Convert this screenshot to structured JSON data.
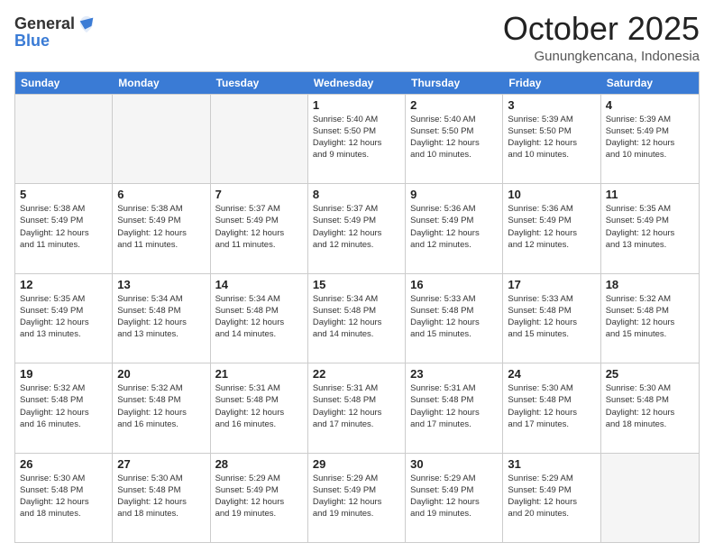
{
  "header": {
    "logo_line1": "General",
    "logo_line2": "Blue",
    "month_title": "October 2025",
    "location": "Gunungkencana, Indonesia"
  },
  "day_headers": [
    "Sunday",
    "Monday",
    "Tuesday",
    "Wednesday",
    "Thursday",
    "Friday",
    "Saturday"
  ],
  "weeks": [
    [
      {
        "num": "",
        "info": ""
      },
      {
        "num": "",
        "info": ""
      },
      {
        "num": "",
        "info": ""
      },
      {
        "num": "1",
        "info": "Sunrise: 5:40 AM\nSunset: 5:50 PM\nDaylight: 12 hours\nand 9 minutes."
      },
      {
        "num": "2",
        "info": "Sunrise: 5:40 AM\nSunset: 5:50 PM\nDaylight: 12 hours\nand 10 minutes."
      },
      {
        "num": "3",
        "info": "Sunrise: 5:39 AM\nSunset: 5:50 PM\nDaylight: 12 hours\nand 10 minutes."
      },
      {
        "num": "4",
        "info": "Sunrise: 5:39 AM\nSunset: 5:49 PM\nDaylight: 12 hours\nand 10 minutes."
      }
    ],
    [
      {
        "num": "5",
        "info": "Sunrise: 5:38 AM\nSunset: 5:49 PM\nDaylight: 12 hours\nand 11 minutes."
      },
      {
        "num": "6",
        "info": "Sunrise: 5:38 AM\nSunset: 5:49 PM\nDaylight: 12 hours\nand 11 minutes."
      },
      {
        "num": "7",
        "info": "Sunrise: 5:37 AM\nSunset: 5:49 PM\nDaylight: 12 hours\nand 11 minutes."
      },
      {
        "num": "8",
        "info": "Sunrise: 5:37 AM\nSunset: 5:49 PM\nDaylight: 12 hours\nand 12 minutes."
      },
      {
        "num": "9",
        "info": "Sunrise: 5:36 AM\nSunset: 5:49 PM\nDaylight: 12 hours\nand 12 minutes."
      },
      {
        "num": "10",
        "info": "Sunrise: 5:36 AM\nSunset: 5:49 PM\nDaylight: 12 hours\nand 12 minutes."
      },
      {
        "num": "11",
        "info": "Sunrise: 5:35 AM\nSunset: 5:49 PM\nDaylight: 12 hours\nand 13 minutes."
      }
    ],
    [
      {
        "num": "12",
        "info": "Sunrise: 5:35 AM\nSunset: 5:49 PM\nDaylight: 12 hours\nand 13 minutes."
      },
      {
        "num": "13",
        "info": "Sunrise: 5:34 AM\nSunset: 5:48 PM\nDaylight: 12 hours\nand 13 minutes."
      },
      {
        "num": "14",
        "info": "Sunrise: 5:34 AM\nSunset: 5:48 PM\nDaylight: 12 hours\nand 14 minutes."
      },
      {
        "num": "15",
        "info": "Sunrise: 5:34 AM\nSunset: 5:48 PM\nDaylight: 12 hours\nand 14 minutes."
      },
      {
        "num": "16",
        "info": "Sunrise: 5:33 AM\nSunset: 5:48 PM\nDaylight: 12 hours\nand 15 minutes."
      },
      {
        "num": "17",
        "info": "Sunrise: 5:33 AM\nSunset: 5:48 PM\nDaylight: 12 hours\nand 15 minutes."
      },
      {
        "num": "18",
        "info": "Sunrise: 5:32 AM\nSunset: 5:48 PM\nDaylight: 12 hours\nand 15 minutes."
      }
    ],
    [
      {
        "num": "19",
        "info": "Sunrise: 5:32 AM\nSunset: 5:48 PM\nDaylight: 12 hours\nand 16 minutes."
      },
      {
        "num": "20",
        "info": "Sunrise: 5:32 AM\nSunset: 5:48 PM\nDaylight: 12 hours\nand 16 minutes."
      },
      {
        "num": "21",
        "info": "Sunrise: 5:31 AM\nSunset: 5:48 PM\nDaylight: 12 hours\nand 16 minutes."
      },
      {
        "num": "22",
        "info": "Sunrise: 5:31 AM\nSunset: 5:48 PM\nDaylight: 12 hours\nand 17 minutes."
      },
      {
        "num": "23",
        "info": "Sunrise: 5:31 AM\nSunset: 5:48 PM\nDaylight: 12 hours\nand 17 minutes."
      },
      {
        "num": "24",
        "info": "Sunrise: 5:30 AM\nSunset: 5:48 PM\nDaylight: 12 hours\nand 17 minutes."
      },
      {
        "num": "25",
        "info": "Sunrise: 5:30 AM\nSunset: 5:48 PM\nDaylight: 12 hours\nand 18 minutes."
      }
    ],
    [
      {
        "num": "26",
        "info": "Sunrise: 5:30 AM\nSunset: 5:48 PM\nDaylight: 12 hours\nand 18 minutes."
      },
      {
        "num": "27",
        "info": "Sunrise: 5:30 AM\nSunset: 5:48 PM\nDaylight: 12 hours\nand 18 minutes."
      },
      {
        "num": "28",
        "info": "Sunrise: 5:29 AM\nSunset: 5:49 PM\nDaylight: 12 hours\nand 19 minutes."
      },
      {
        "num": "29",
        "info": "Sunrise: 5:29 AM\nSunset: 5:49 PM\nDaylight: 12 hours\nand 19 minutes."
      },
      {
        "num": "30",
        "info": "Sunrise: 5:29 AM\nSunset: 5:49 PM\nDaylight: 12 hours\nand 19 minutes."
      },
      {
        "num": "31",
        "info": "Sunrise: 5:29 AM\nSunset: 5:49 PM\nDaylight: 12 hours\nand 20 minutes."
      },
      {
        "num": "",
        "info": ""
      }
    ]
  ]
}
